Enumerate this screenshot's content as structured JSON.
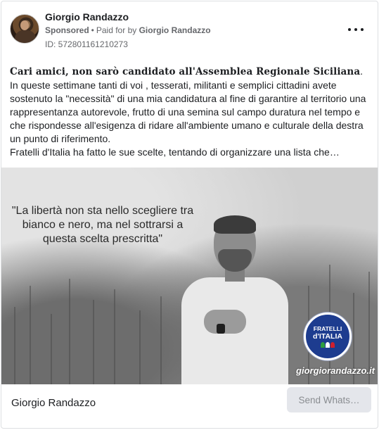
{
  "header": {
    "page_name": "Giorgio Randazzo",
    "sponsored_label": "Sponsored",
    "separator": "•",
    "paid_for_prefix": "Paid for by",
    "payer": "Giorgio Randazzo",
    "ad_id": "ID: 572801161210273",
    "more_icon": "more-options-icon"
  },
  "post": {
    "headline": "Cari amici, non sarò candidato all'Assemblea Regionale Siciliana",
    "headline_end": ".",
    "paragraph1": "In queste settimane tanti di voi , tesserati, militanti e semplici cittadini avete sostenuto la \"necessità\" di una mia candidatura al fine di garantire al territorio una rappresentanza autorevole, frutto di una semina sul campo duratura nel tempo e che rispondesse all'esigenza di ridare all'ambiente umano e culturale della destra un punto di riferimento.",
    "paragraph2": "Fratelli d'Italia ha fatto le sue scelte, tentando di organizzare una lista che…"
  },
  "image": {
    "quote": "\"La libertà non sta nello scegliere tra bianco e nero, ma nel sottrarsi a questa scelta prescritta\"",
    "logo_line1": "FRATELLI",
    "logo_line2": "d'ITALIA",
    "site_url": "giorgiorandazzo.it",
    "colors": {
      "logo_blue": "#1d3c8f",
      "flag_green": "#2e9d3e",
      "flag_white": "#ffffff",
      "flag_red": "#d0202e"
    }
  },
  "footer": {
    "title": "Giorgio Randazzo",
    "cta_label": "Send Whats…"
  }
}
